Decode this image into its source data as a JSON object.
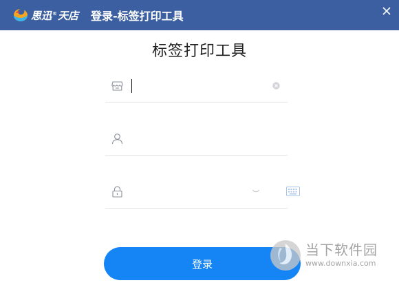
{
  "titlebar": {
    "brand_name": "思迅",
    "brand_mark": "®",
    "brand_suffix": "天店",
    "title": "登录-标签打印工具",
    "background_color": "#3b5fa0",
    "close_icon": "close-icon"
  },
  "main": {
    "heading": "标签打印工具"
  },
  "form": {
    "store_field": {
      "icon": "store-icon",
      "value": "",
      "placeholder": "",
      "clear_icon": "clear-circle-icon",
      "focused": true
    },
    "user_field": {
      "icon": "user-icon",
      "value": "",
      "placeholder": ""
    },
    "password_field": {
      "icon": "lock-icon",
      "value": "",
      "placeholder": "",
      "visibility_icon": "eye-closed-icon",
      "keyboard_icon": "keyboard-icon"
    },
    "login_label": "登录",
    "login_color": "#1585f5"
  },
  "watermark": {
    "name": "当下软件园",
    "url": "www.downxia.com"
  }
}
